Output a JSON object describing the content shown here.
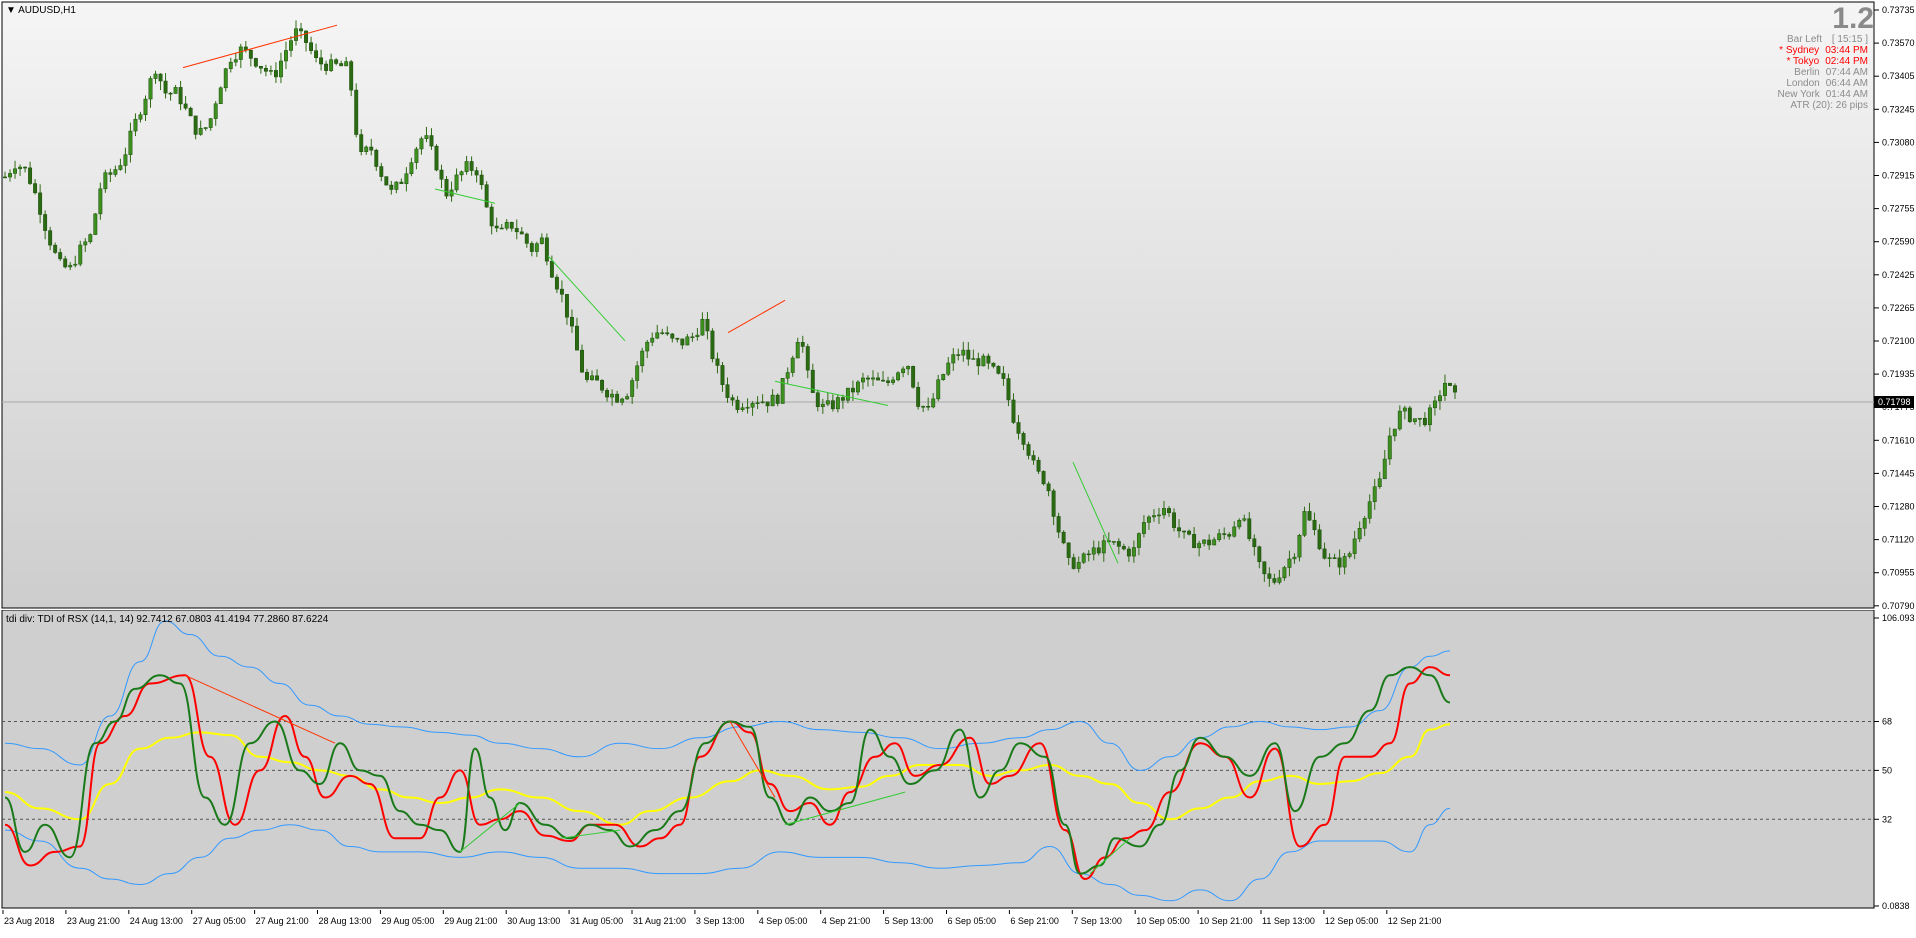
{
  "window": {
    "symbol_label": "AUDUSD,H1",
    "indicator_label": "tdi div: TDI of RSX  (14,1, 14) 92.7412 67.0803 41.4194 77.2860 87.6224"
  },
  "info_panel": {
    "big_number": "1.2",
    "rows": [
      {
        "label": "Bar Left",
        "value": "[ 15:15 ]",
        "color": "#8c8c8c"
      },
      {
        "label": "* Sydney",
        "value": "03:44 PM",
        "color": "#ff0000"
      },
      {
        "label": "* Tokyo",
        "value": "02:44 PM",
        "color": "#ff0000"
      },
      {
        "label": "Berlin",
        "value": "07:44 AM",
        "color": "#8c8c8c"
      },
      {
        "label": "London",
        "value": "06:44 AM",
        "color": "#8c8c8c"
      },
      {
        "label": "New York",
        "value": "01:44 AM",
        "color": "#8c8c8c"
      }
    ],
    "atr": "ATR (20): 26 pips"
  },
  "price_axis": {
    "labels": [
      "0.73735",
      "0.73570",
      "0.73405",
      "0.73245",
      "0.73080",
      "0.72915",
      "0.72755",
      "0.72590",
      "0.72425",
      "0.72265",
      "0.72100",
      "0.71935",
      "0.71775",
      "0.71610",
      "0.71445",
      "0.71280",
      "0.71120",
      "0.70955",
      "0.70790"
    ],
    "current_price": "0.71798"
  },
  "indicator_axis": {
    "labels": [
      "106.093",
      "68",
      "50",
      "32",
      "0.0838"
    ],
    "bottom_overlap": "0.0c"
  },
  "time_axis": {
    "labels": [
      "23 Aug 2018",
      "23 Aug 21:00",
      "24 Aug 13:00",
      "27 Aug 05:00",
      "27 Aug 21:00",
      "28 Aug 13:00",
      "29 Aug 05:00",
      "29 Aug 21:00",
      "30 Aug 13:00",
      "31 Aug 05:00",
      "31 Aug 21:00",
      "3 Sep 13:00",
      "4 Sep 05:00",
      "4 Sep 21:00",
      "5 Sep 13:00",
      "6 Sep 05:00",
      "6 Sep 21:00",
      "7 Sep 13:00",
      "10 Sep 05:00",
      "10 Sep 21:00",
      "11 Sep 13:00",
      "12 Sep 05:00",
      "12 Sep 21:00"
    ]
  },
  "colors": {
    "bg_main_top": "#f4f4f4",
    "bg_main_bottom": "#cfcfcf",
    "candle": "#2e7d1a",
    "down_wick": "#8b5a2b",
    "div_red": "#ff3300",
    "div_green": "#33cc33",
    "tdi_green": "#1a7a1a",
    "tdi_red": "#ff0000",
    "tdi_yellow": "#ffff00",
    "tdi_band": "#3399ff"
  },
  "chart_data": {
    "type": "candlestick",
    "ohlc_path": [
      0.7291,
      0.7298,
      0.7294,
      0.728,
      0.7262,
      0.7248,
      0.7245,
      0.7255,
      0.7262,
      0.7289,
      0.7293,
      0.73,
      0.7316,
      0.733,
      0.7345,
      0.7332,
      0.7333,
      0.7322,
      0.7312,
      0.7317,
      0.7336,
      0.735,
      0.7354,
      0.735,
      0.7345,
      0.734,
      0.7352,
      0.7363,
      0.7358,
      0.7348,
      0.7346,
      0.7346,
      0.7345,
      0.73,
      0.7306,
      0.7293,
      0.7283,
      0.729,
      0.7303,
      0.7312,
      0.73,
      0.7282,
      0.729,
      0.7296,
      0.7294,
      0.7272,
      0.7262,
      0.7268,
      0.7263,
      0.7255,
      0.726,
      0.7243,
      0.723,
      0.721,
      0.719,
      0.719,
      0.7185,
      0.7182,
      0.7185,
      0.72,
      0.7212,
      0.7215,
      0.721,
      0.7209,
      0.7212,
      0.722,
      0.72,
      0.7186,
      0.7178,
      0.718,
      0.7181,
      0.718,
      0.7182,
      0.7198,
      0.7215,
      0.7185,
      0.7177,
      0.7178,
      0.7182,
      0.7186,
      0.7191,
      0.719,
      0.7188,
      0.7195,
      0.72,
      0.718,
      0.7175,
      0.719,
      0.72,
      0.7205,
      0.72,
      0.72,
      0.7195,
      0.7189,
      0.717,
      0.716,
      0.7145,
      0.714,
      0.7118,
      0.71,
      0.71,
      0.7105,
      0.7108,
      0.711,
      0.7107,
      0.7105,
      0.712,
      0.7125,
      0.7128,
      0.7118,
      0.7112,
      0.711,
      0.711,
      0.7113,
      0.7115,
      0.7125,
      0.711,
      0.7095,
      0.709,
      0.7098,
      0.7105,
      0.7125,
      0.7115,
      0.7102,
      0.71,
      0.7102,
      0.7118,
      0.713,
      0.714,
      0.7165,
      0.7175,
      0.7172,
      0.717,
      0.7176,
      0.719,
      0.7182
    ],
    "divergences": [
      {
        "color": "red",
        "from_price": 0.7345,
        "to_price": 0.7366
      },
      {
        "color": "green",
        "from_price": 0.7285,
        "to_price": 0.7278
      },
      {
        "color": "green",
        "from_price": 0.7252,
        "to_price": 0.721
      },
      {
        "color": "red",
        "from_price": 0.7214,
        "to_price": 0.723
      },
      {
        "color": "green",
        "from_price": 0.719,
        "to_price": 0.7178
      },
      {
        "color": "green",
        "from_price": 0.715,
        "to_price": 0.71
      }
    ]
  }
}
